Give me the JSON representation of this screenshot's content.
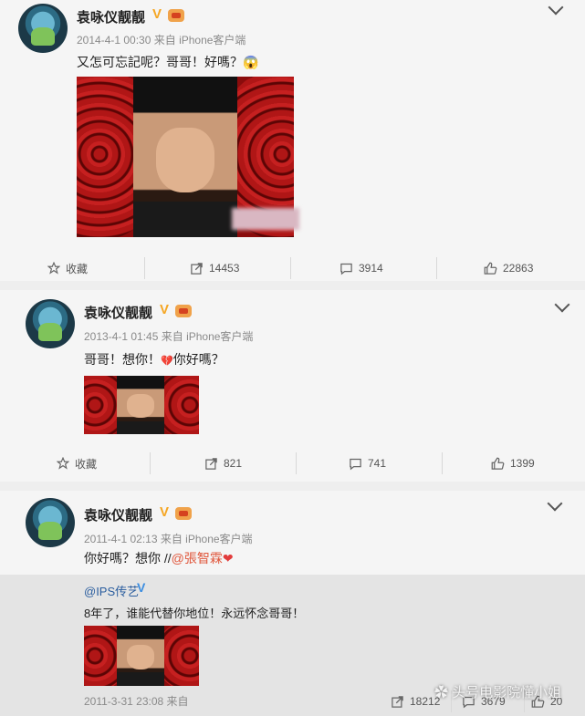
{
  "posts": [
    {
      "name": "袁咏仪靓靓",
      "meta": "2014-4-1 00:30 来自 iPhone客户端",
      "text": "又怎可忘記呢？哥哥！好嗎？😱",
      "actions": {
        "collect": "收藏",
        "repost": "14453",
        "comment": "3914",
        "like": "22863"
      }
    },
    {
      "name": "袁咏仪靓靓",
      "meta": "2013-4-1 01:45 来自 iPhone客户端",
      "text_before": "哥哥！想你！",
      "text_after": "你好嗎？",
      "heart_emoji": "💔",
      "actions": {
        "collect": "收藏",
        "repost": "821",
        "comment": "741",
        "like": "1399"
      }
    },
    {
      "name": "袁咏仪靓靓",
      "meta": "2011-4-1 02:13 来自 iPhone客户端",
      "text_before": "你好嗎？想你 //",
      "mention": "@張智霖",
      "heart": "❤",
      "quote": {
        "name": "@IPS传艺",
        "text": "8年了，谁能代替你地位！永远怀念哥哥！",
        "meta": "2011-3-31 23:08 来自",
        "repost": "18212",
        "comment": "3679",
        "like": "20"
      }
    }
  ],
  "badges": {
    "vip": "V",
    "verified": "V"
  },
  "watermark": "头号电影院懂小姐",
  "colors": {
    "vip_badge": "#f5a623",
    "verified_badge": "#3d8ee0",
    "mention": "#e0573c"
  }
}
